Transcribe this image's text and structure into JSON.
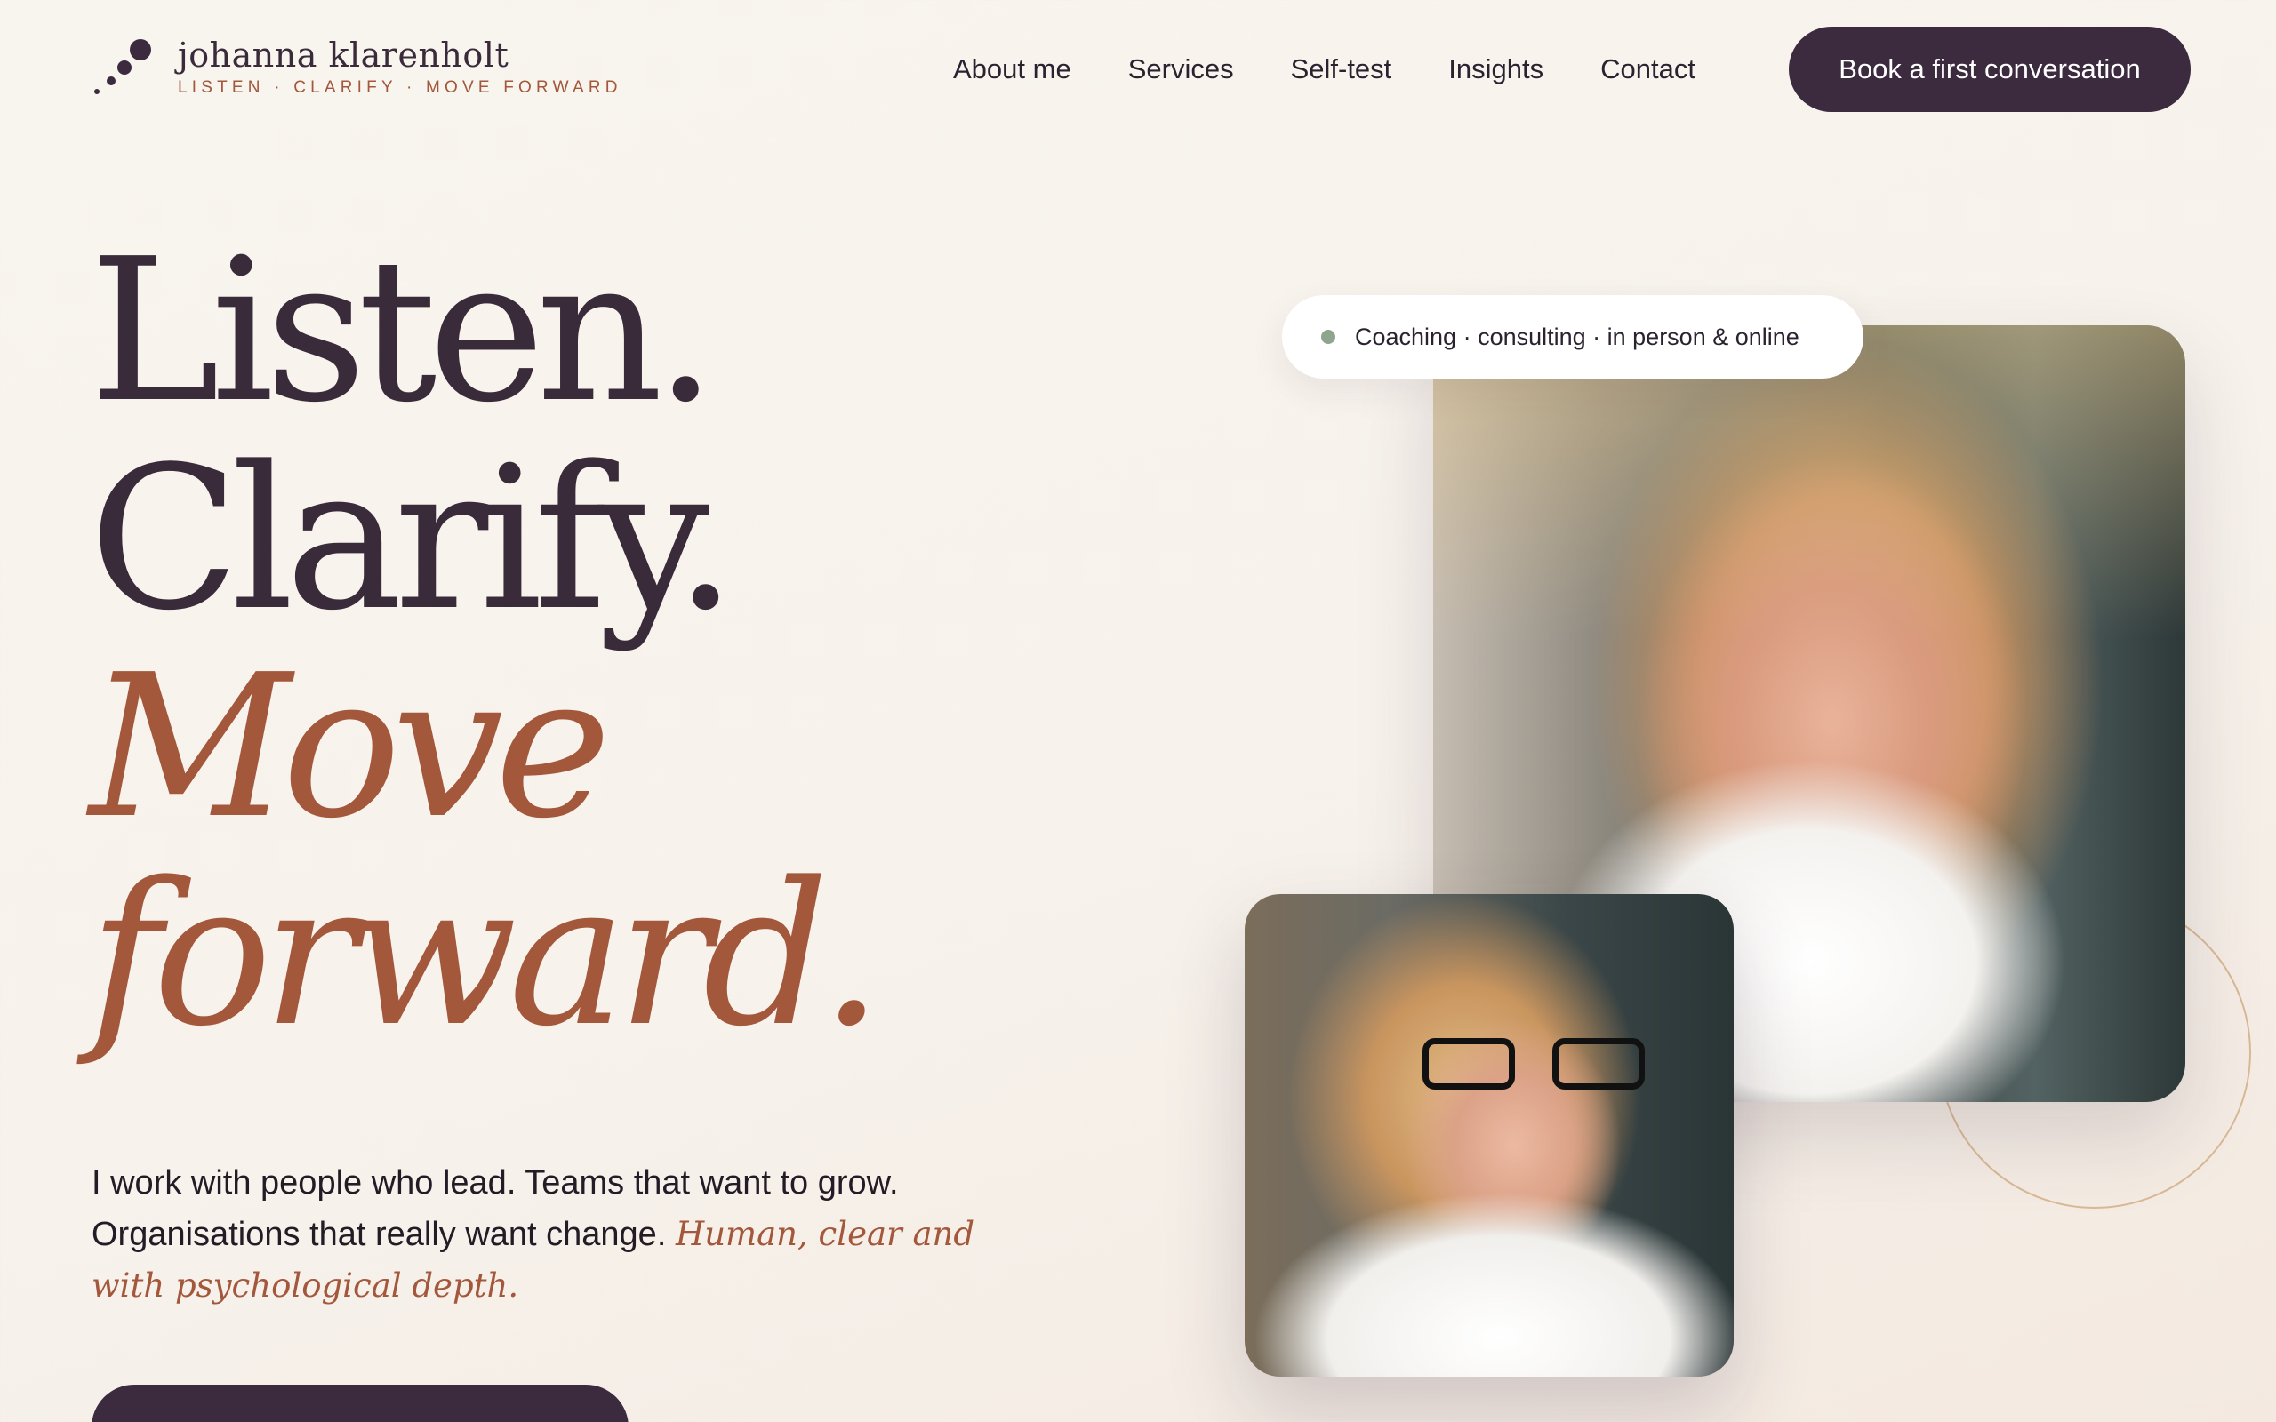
{
  "brand": {
    "name": "johanna klarenholt",
    "tagline": "LISTEN · CLARIFY · MOVE FORWARD"
  },
  "nav": {
    "items": [
      {
        "label": "About me"
      },
      {
        "label": "Services"
      },
      {
        "label": "Self-test"
      },
      {
        "label": "Insights"
      },
      {
        "label": "Contact"
      }
    ],
    "cta_label": "Book a first conversation"
  },
  "hero": {
    "lines": [
      "Listen.",
      "Clarify.",
      "Move",
      "forward."
    ],
    "intro_text": "I work with people who lead. Teams that want to grow. Organisations that really want change.",
    "intro_accent": "Human, clear and with psychological depth.",
    "badge_text": "Coaching · consulting · in person & online"
  },
  "colors": {
    "primary": "#3c2a3f",
    "accent": "#a3573b",
    "background": "#f8f4ee",
    "badge_dot": "#8fa58e"
  }
}
